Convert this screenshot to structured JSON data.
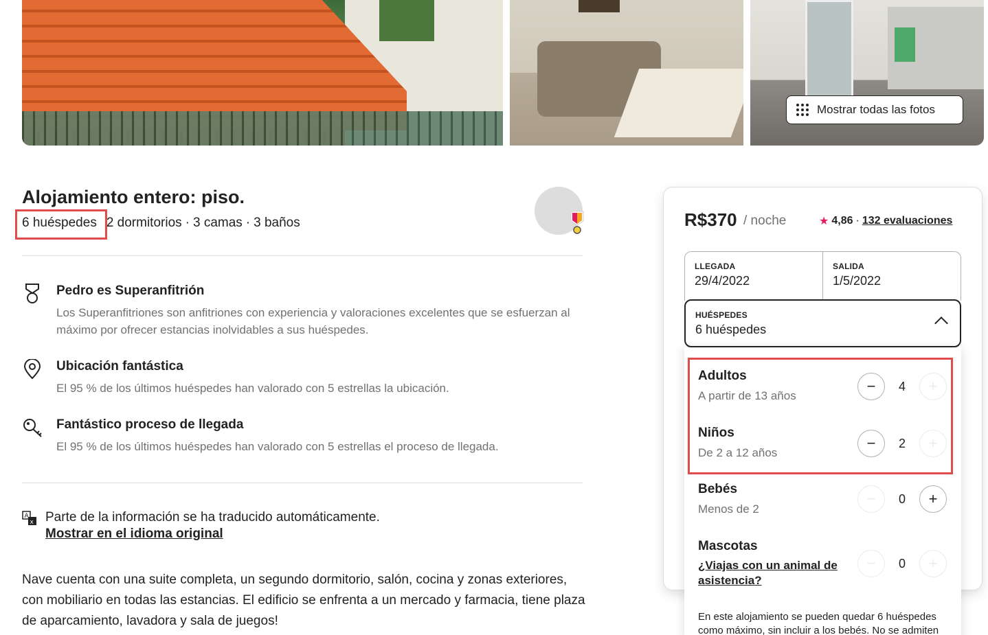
{
  "photos": {
    "show_all_label": "Mostrar todas las fotos",
    "show_all_icon": "grid-dots-icon"
  },
  "listing": {
    "title": "Alojamiento entero: piso.",
    "guests": "6 huéspedes",
    "sep1": "·",
    "bedrooms": "2 dormitorios",
    "sep2": "·",
    "beds": "3 camas",
    "sep3": "·",
    "baths": "3 baños"
  },
  "features": [
    {
      "icon": "superhost-medal-icon",
      "title": "Pedro es Superanfitrión",
      "text": "Los Superanfitriones son anfitriones con experiencia y valoraciones excelentes que se esfuerzan al máximo por ofrecer estancias inolvidables a sus huéspedes."
    },
    {
      "icon": "location-pin-icon",
      "title": "Ubicación fantástica",
      "text": "El 95 % de los últimos huéspedes han valorado con 5 estrellas la ubicación."
    },
    {
      "icon": "key-icon",
      "title": "Fantástico proceso de llegada",
      "text": "El 95 % de los últimos huéspedes han valorado con 5 estrellas el proceso de llegada."
    }
  ],
  "translation": {
    "icon": "translate-icon",
    "text": "Parte de la información se ha traducido automáticamente.",
    "link": "Mostrar en el idioma original"
  },
  "description": "Nave cuenta con una suite completa, un segundo dormitorio, salón, cocina y zonas exteriores, con mobiliario en todas las estancias. El edificio se enfrenta a un mercado y farmacia, tiene plaza de aparcamiento, lavadora y sala de juegos!",
  "booking": {
    "price": "R$370",
    "per_night": "/ noche",
    "rating": "4,86",
    "dot": "·",
    "reviews": "132 evaluaciones",
    "checkin_label": "LLEGADA",
    "checkin_value": "29/4/2022",
    "checkout_label": "SALIDA",
    "checkout_value": "1/5/2022",
    "guests_label": "HUÉSPEDES",
    "guests_value": "6 huéspedes"
  },
  "guest_types": [
    {
      "name": "Adultos",
      "sub": "A partir de 13 años",
      "count": "4",
      "minus_enabled": true,
      "plus_enabled": false
    },
    {
      "name": "Niños",
      "sub": "De 2 a 12 años",
      "count": "2",
      "minus_enabled": true,
      "plus_enabled": false
    },
    {
      "name": "Bebés",
      "sub": "Menos de 2",
      "count": "0",
      "minus_enabled": false,
      "plus_enabled": true
    },
    {
      "name": "Mascotas",
      "link": "¿Viajas con un animal de asistencia?",
      "count": "0",
      "minus_enabled": false,
      "plus_enabled": false
    }
  ],
  "guest_note": "En este alojamiento se pueden quedar 6 huéspedes como máximo, sin incluir a los bebés. No se admiten",
  "colors": {
    "accent": "#e31c5f",
    "highlight": "#e04b4b",
    "muted": "#717171"
  }
}
